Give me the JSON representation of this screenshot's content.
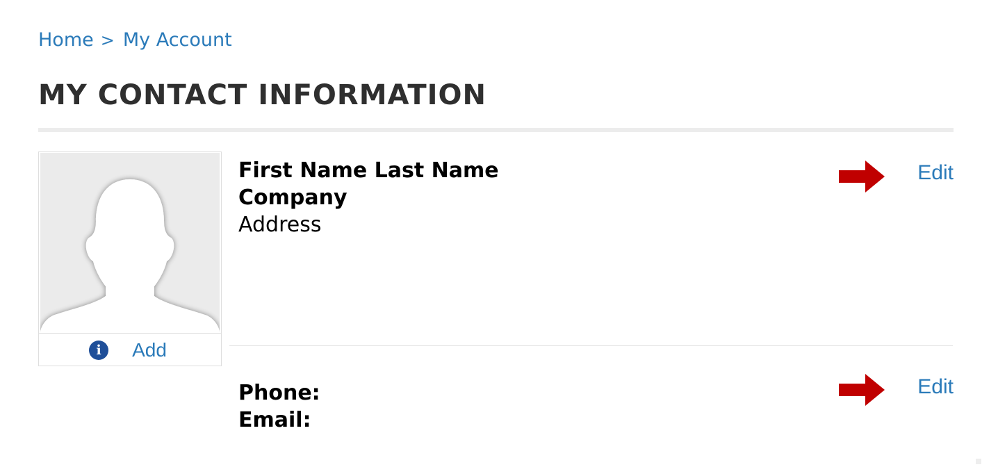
{
  "breadcrumb": {
    "home": "Home",
    "separator": ">",
    "current": "My Account"
  },
  "page_title": "MY CONTACT INFORMATION",
  "photo": {
    "add_label": "Add",
    "info_icon_glyph": "i",
    "icon": "info-icon"
  },
  "contact": {
    "name": "First Name Last Name",
    "company": "Company",
    "address": "Address",
    "phone_label": "Phone:",
    "email_label": "Email:",
    "edit_label_1": "Edit",
    "edit_label_2": "Edit"
  },
  "colors": {
    "link": "#2a7ab9",
    "arrow": "#c00000",
    "title": "#2f2f2f",
    "info_icon": "#1f4f99"
  }
}
